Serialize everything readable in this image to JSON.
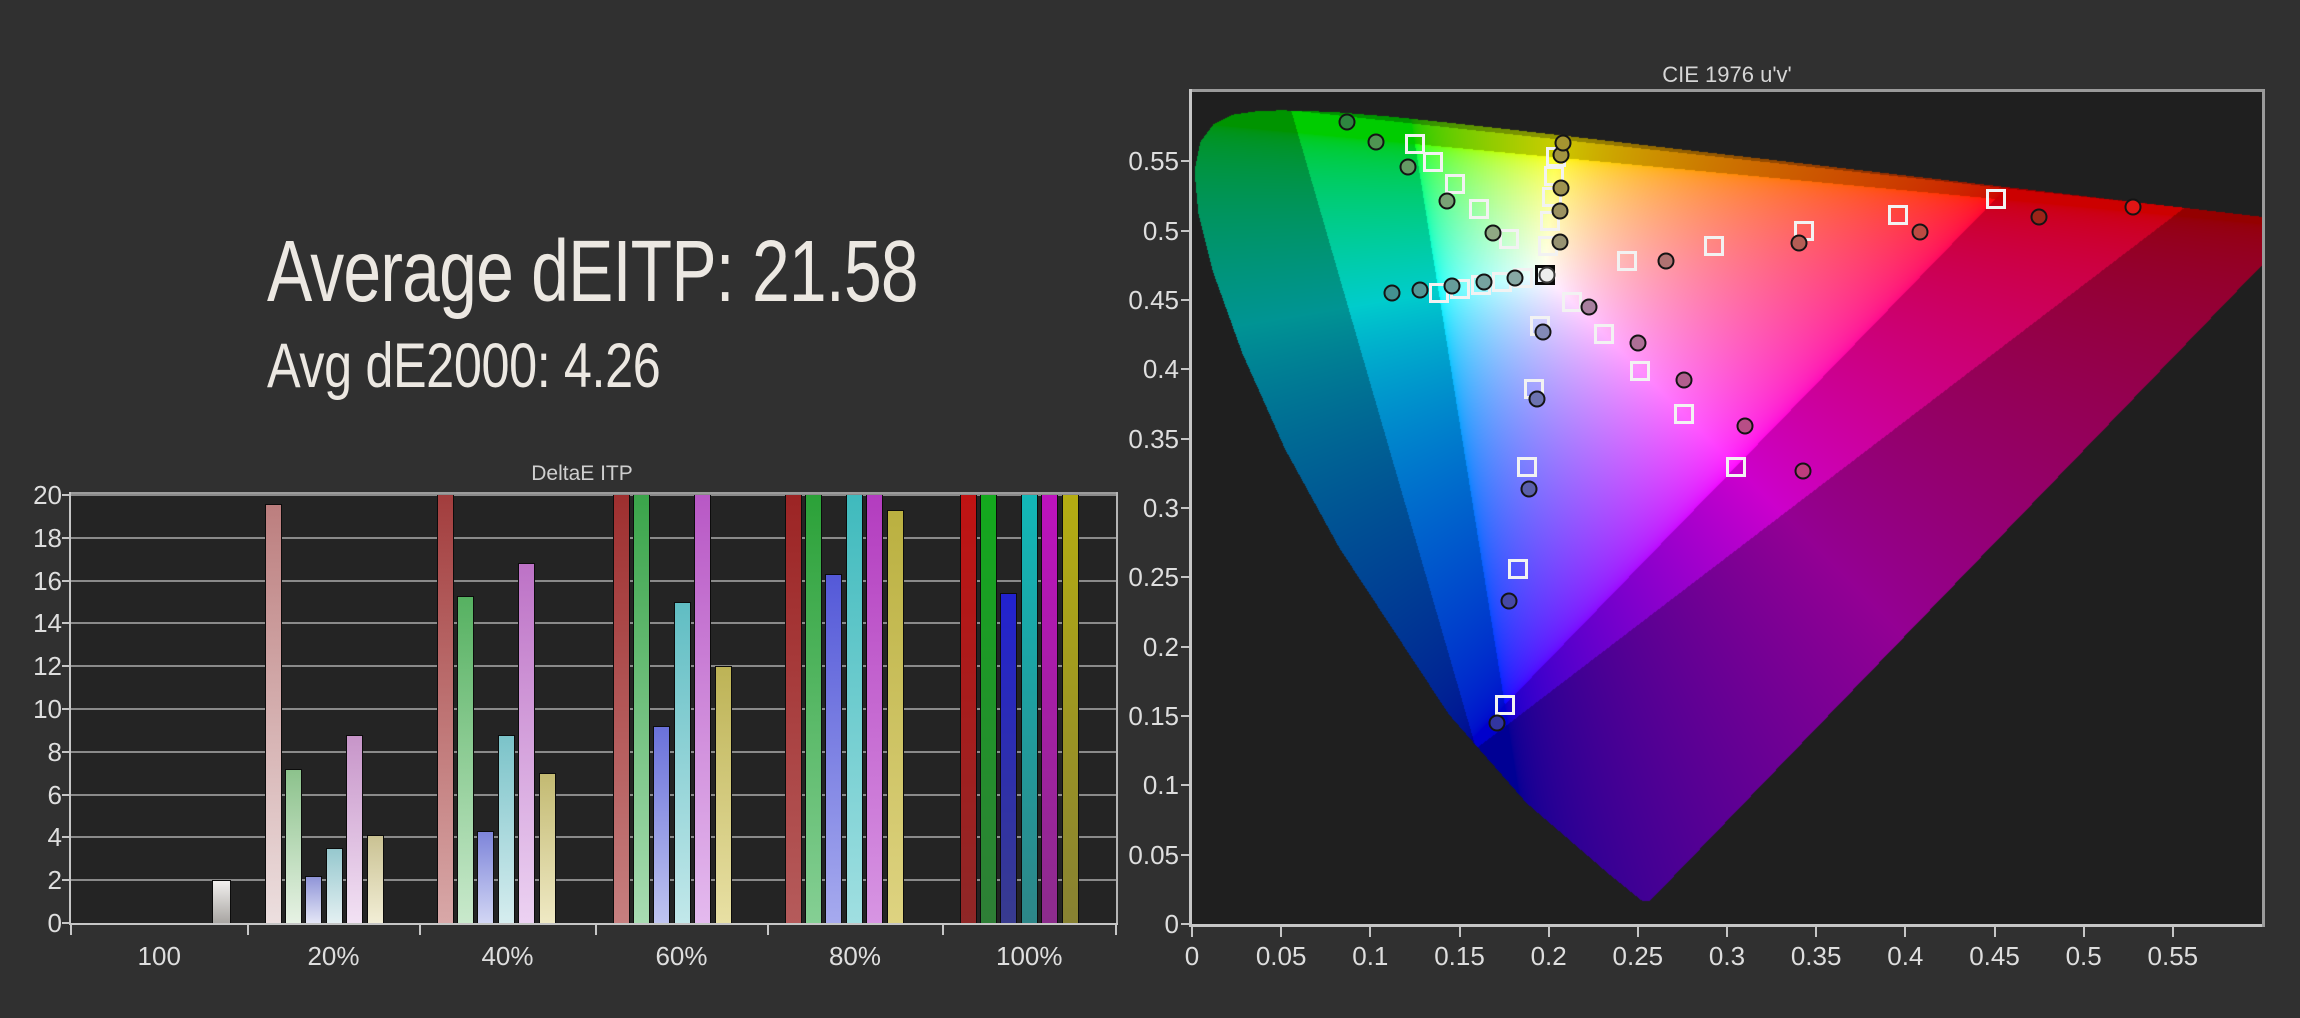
{
  "page": {
    "background": "#303030"
  },
  "summary": {
    "avg_deitp": "Average dEITP: 21.58",
    "avg_de2000": "Avg dE2000: 4.26"
  },
  "chart_data": [
    {
      "type": "bar",
      "title": "DeltaE ITP",
      "xlabel": "",
      "ylabel": "",
      "ylim": [
        0,
        20
      ],
      "yticks": [
        0,
        2,
        4,
        6,
        8,
        10,
        12,
        14,
        16,
        18,
        20
      ],
      "categories": [
        "100",
        "20%",
        "40%",
        "60%",
        "80%",
        "100%"
      ],
      "series_order": [
        "white",
        "red",
        "green",
        "blue",
        "cyan",
        "magenta",
        "yellow"
      ],
      "groups": [
        {
          "label": "100",
          "bars": [
            {
              "series": "white",
              "value": 2.0,
              "clipped": false,
              "color_top": "#f2f0ee",
              "color_bottom": "#a8a5a2"
            }
          ]
        },
        {
          "label": "20%",
          "bars": [
            {
              "series": "red",
              "value": 19.6,
              "clipped": false,
              "color_top": "#bc7e7e",
              "color_bottom": "#ecdfdf"
            },
            {
              "series": "green",
              "value": 7.2,
              "clipped": false,
              "color_top": "#8cc28c",
              "color_bottom": "#e7f2e4"
            },
            {
              "series": "blue",
              "value": 2.2,
              "clipped": false,
              "color_top": "#9095d8",
              "color_bottom": "#e4e6f6"
            },
            {
              "series": "cyan",
              "value": 3.5,
              "clipped": false,
              "color_top": "#96c8ce",
              "color_bottom": "#e4f0f2"
            },
            {
              "series": "magenta",
              "value": 8.8,
              "clipped": false,
              "color_top": "#c795c9",
              "color_bottom": "#f2e2f4"
            },
            {
              "series": "yellow",
              "value": 4.1,
              "clipped": false,
              "color_top": "#cac293",
              "color_bottom": "#f2eed6"
            }
          ]
        },
        {
          "label": "40%",
          "bars": [
            {
              "series": "red",
              "value": 20,
              "clipped": true,
              "color_top": "#a23d3d",
              "color_bottom": "#d8a8a8"
            },
            {
              "series": "green",
              "value": 15.3,
              "clipped": false,
              "color_top": "#56b161",
              "color_bottom": "#c9e9cc"
            },
            {
              "series": "blue",
              "value": 4.3,
              "clipped": false,
              "color_top": "#7e85da",
              "color_bottom": "#d2d6f4"
            },
            {
              "series": "cyan",
              "value": 8.8,
              "clipped": false,
              "color_top": "#7bc3c9",
              "color_bottom": "#d6edef"
            },
            {
              "series": "magenta",
              "value": 16.8,
              "clipped": false,
              "color_top": "#bd72c6",
              "color_bottom": "#ecd2f2"
            },
            {
              "series": "yellow",
              "value": 7.0,
              "clipped": false,
              "color_top": "#c3ba72",
              "color_bottom": "#efe9c4"
            }
          ]
        },
        {
          "label": "60%",
          "bars": [
            {
              "series": "red",
              "value": 20,
              "clipped": true,
              "color_top": "#9e2f2f",
              "color_bottom": "#c67f7f"
            },
            {
              "series": "green",
              "value": 20,
              "clipped": true,
              "color_top": "#3aa44a",
              "color_bottom": "#a8dcb2"
            },
            {
              "series": "blue",
              "value": 9.2,
              "clipped": false,
              "color_top": "#6a71da",
              "color_bottom": "#bfc4f0"
            },
            {
              "series": "cyan",
              "value": 15.0,
              "clipped": false,
              "color_top": "#60bdc3",
              "color_bottom": "#c2e8ea"
            },
            {
              "series": "magenta",
              "value": 20,
              "clipped": true,
              "color_top": "#b858c5",
              "color_bottom": "#e4baee"
            },
            {
              "series": "yellow",
              "value": 12.0,
              "clipped": false,
              "color_top": "#bdb356",
              "color_bottom": "#e8e0a4"
            }
          ]
        },
        {
          "label": "80%",
          "bars": [
            {
              "series": "red",
              "value": 20,
              "clipped": true,
              "color_top": "#9c2424",
              "color_bottom": "#b55b5b"
            },
            {
              "series": "green",
              "value": 20,
              "clipped": true,
              "color_top": "#2ba138",
              "color_bottom": "#85cf94"
            },
            {
              "series": "blue",
              "value": 16.3,
              "clipped": false,
              "color_top": "#5459d8",
              "color_bottom": "#a6aaee"
            },
            {
              "series": "cyan",
              "value": 20,
              "clipped": true,
              "color_top": "#3fbabd",
              "color_bottom": "#a0dfe1"
            },
            {
              "series": "magenta",
              "value": 20,
              "clipped": true,
              "color_top": "#b33cbf",
              "color_bottom": "#d795e3"
            },
            {
              "series": "yellow",
              "value": 19.3,
              "clipped": false,
              "color_top": "#bab040",
              "color_bottom": "#ded381"
            }
          ]
        },
        {
          "label": "100%",
          "bars": [
            {
              "series": "red",
              "value": 20,
              "clipped": true,
              "color_top": "#c01313",
              "color_bottom": "#8e2727"
            },
            {
              "series": "green",
              "value": 20,
              "clipped": true,
              "color_top": "#13a91d",
              "color_bottom": "#2e7e36"
            },
            {
              "series": "blue",
              "value": 15.4,
              "clipped": false,
              "color_top": "#2222cf",
              "color_bottom": "#383b8e"
            },
            {
              "series": "cyan",
              "value": 20,
              "clipped": true,
              "color_top": "#12b7b7",
              "color_bottom": "#2d8688"
            },
            {
              "series": "magenta",
              "value": 20,
              "clipped": true,
              "color_top": "#bd12bd",
              "color_bottom": "#8c2c8c"
            },
            {
              "series": "yellow",
              "value": 20,
              "clipped": true,
              "color_top": "#b5ad12",
              "color_bottom": "#878132"
            }
          ]
        }
      ]
    },
    {
      "type": "scatter",
      "title": "CIE 1976 u'v'",
      "xlim": [
        0,
        0.6
      ],
      "ylim": [
        0,
        0.6
      ],
      "xtick_labels": [
        "0",
        "0.05",
        "0.1",
        "0.15",
        "0.2",
        "0.25",
        "0.3",
        "0.35",
        "0.4",
        "0.45",
        "0.5",
        "0.55"
      ],
      "xtick_values": [
        0,
        0.05,
        0.1,
        0.15,
        0.2,
        0.25,
        0.3,
        0.35,
        0.4,
        0.45,
        0.5,
        0.55
      ],
      "ytick_labels": [
        "0",
        "0.05",
        "0.1",
        "0.15",
        "0.2",
        "0.25",
        "0.3",
        "0.35",
        "0.4",
        "0.45",
        "0.5",
        "0.55"
      ],
      "ytick_values": [
        0,
        0.05,
        0.1,
        0.15,
        0.2,
        0.25,
        0.3,
        0.35,
        0.4,
        0.45,
        0.5,
        0.55
      ],
      "white_point_target": {
        "name": "white-point",
        "u": 0.1978,
        "v": 0.4683
      },
      "white_point_measured": {
        "name": "white-point",
        "u": 0.199,
        "v": 0.468,
        "color": "#ededed"
      },
      "targets": [
        {
          "name": "red-20",
          "u": 0.2442,
          "v": 0.4783
        },
        {
          "name": "red-40",
          "u": 0.2925,
          "v": 0.4888
        },
        {
          "name": "red-60",
          "u": 0.3431,
          "v": 0.4996
        },
        {
          "name": "red-80",
          "u": 0.3957,
          "v": 0.511
        },
        {
          "name": "red-100",
          "u": 0.4507,
          "v": 0.5229
        },
        {
          "name": "green-20",
          "u": 0.1778,
          "v": 0.4942
        },
        {
          "name": "green-40",
          "u": 0.1612,
          "v": 0.5157
        },
        {
          "name": "green-60",
          "u": 0.1472,
          "v": 0.5338
        },
        {
          "name": "green-80",
          "u": 0.1353,
          "v": 0.5492
        },
        {
          "name": "green-100",
          "u": 0.125,
          "v": 0.5625
        },
        {
          "name": "blue-20",
          "u": 0.1952,
          "v": 0.4313
        },
        {
          "name": "blue-40",
          "u": 0.1918,
          "v": 0.3861
        },
        {
          "name": "blue-60",
          "u": 0.1878,
          "v": 0.3293
        },
        {
          "name": "blue-80",
          "u": 0.1826,
          "v": 0.2561
        },
        {
          "name": "blue-100",
          "u": 0.1754,
          "v": 0.1579
        },
        {
          "name": "cyan-20",
          "u": 0.1857,
          "v": 0.4656
        },
        {
          "name": "cyan-40",
          "u": 0.1737,
          "v": 0.4631
        },
        {
          "name": "cyan-60",
          "u": 0.1618,
          "v": 0.4605
        },
        {
          "name": "cyan-80",
          "u": 0.15,
          "v": 0.458
        },
        {
          "name": "cyan-100",
          "u": 0.1383,
          "v": 0.4554
        },
        {
          "name": "magenta-20",
          "u": 0.2131,
          "v": 0.4485
        },
        {
          "name": "magenta-40",
          "u": 0.2308,
          "v": 0.4257
        },
        {
          "name": "magenta-60",
          "u": 0.2514,
          "v": 0.3991
        },
        {
          "name": "magenta-80",
          "u": 0.2758,
          "v": 0.3675
        },
        {
          "name": "magenta-100",
          "u": 0.305,
          "v": 0.3297
        },
        {
          "name": "yellow-20",
          "u": 0.1994,
          "v": 0.489
        },
        {
          "name": "yellow-40",
          "u": 0.2006,
          "v": 0.5073
        },
        {
          "name": "yellow-60",
          "u": 0.2021,
          "v": 0.5243
        },
        {
          "name": "yellow-80",
          "u": 0.203,
          "v": 0.5393
        },
        {
          "name": "yellow-100",
          "u": 0.2039,
          "v": 0.5529
        }
      ],
      "measurements": [
        {
          "name": "red-20",
          "u": 0.266,
          "v": 0.478,
          "color": "#b07272"
        },
        {
          "name": "red-40",
          "u": 0.3406,
          "v": 0.4909,
          "color": "#b55d55"
        },
        {
          "name": "red-60",
          "u": 0.4082,
          "v": 0.4993,
          "color": "#bc4a42"
        },
        {
          "name": "red-80",
          "u": 0.4748,
          "v": 0.5101,
          "color": "#9c2418"
        },
        {
          "name": "red-100",
          "u": 0.5275,
          "v": 0.5173,
          "color": "#e01515"
        },
        {
          "name": "green-20",
          "u": 0.1687,
          "v": 0.4981,
          "color": "#8fa883"
        },
        {
          "name": "green-40",
          "u": 0.1432,
          "v": 0.5211,
          "color": "#79a275"
        },
        {
          "name": "green-60",
          "u": 0.1214,
          "v": 0.546,
          "color": "#659a64"
        },
        {
          "name": "green-80",
          "u": 0.1033,
          "v": 0.564,
          "color": "#4f9452"
        },
        {
          "name": "green-100",
          "u": 0.0868,
          "v": 0.5786,
          "color": "#2e8540"
        },
        {
          "name": "blue-20",
          "u": 0.1967,
          "v": 0.4268,
          "color": "#8289b5"
        },
        {
          "name": "blue-40",
          "u": 0.1934,
          "v": 0.3789,
          "color": "#6d73b0"
        },
        {
          "name": "blue-60",
          "u": 0.189,
          "v": 0.3134,
          "color": "#5a5fab"
        },
        {
          "name": "blue-80",
          "u": 0.178,
          "v": 0.233,
          "color": "#4648a5"
        },
        {
          "name": "blue-100",
          "u": 0.171,
          "v": 0.145,
          "color": "#32359f"
        },
        {
          "name": "cyan-20",
          "u": 0.1813,
          "v": 0.466,
          "color": "#87a8a4"
        },
        {
          "name": "cyan-40",
          "u": 0.1636,
          "v": 0.4628,
          "color": "#76a3a0"
        },
        {
          "name": "cyan-60",
          "u": 0.1458,
          "v": 0.4602,
          "color": "#659d9b"
        },
        {
          "name": "cyan-80",
          "u": 0.128,
          "v": 0.4573,
          "color": "#549795"
        },
        {
          "name": "cyan-100",
          "u": 0.1121,
          "v": 0.4552,
          "color": "#439190"
        },
        {
          "name": "magenta-20",
          "u": 0.2227,
          "v": 0.4451,
          "color": "#a87f9e"
        },
        {
          "name": "magenta-40",
          "u": 0.2501,
          "v": 0.419,
          "color": "#ad6f96"
        },
        {
          "name": "magenta-60",
          "u": 0.2759,
          "v": 0.3923,
          "color": "#b25e8e"
        },
        {
          "name": "magenta-80",
          "u": 0.3101,
          "v": 0.3592,
          "color": "#b84e86"
        },
        {
          "name": "magenta-100",
          "u": 0.3427,
          "v": 0.3269,
          "color": "#bd3d7d"
        },
        {
          "name": "yellow-20",
          "u": 0.2066,
          "v": 0.4916,
          "color": "#979372"
        },
        {
          "name": "yellow-40",
          "u": 0.2066,
          "v": 0.514,
          "color": "#9b9260"
        },
        {
          "name": "yellow-60",
          "u": 0.207,
          "v": 0.531,
          "color": "#9e9350"
        },
        {
          "name": "yellow-80",
          "u": 0.207,
          "v": 0.5547,
          "color": "#a29440"
        },
        {
          "name": "yellow-100",
          "u": 0.208,
          "v": 0.563,
          "color": "#a59530"
        }
      ],
      "gamuts": {
        "rec709": [
          [
            0.4507,
            0.5229
          ],
          [
            0.125,
            0.5625
          ],
          [
            0.1754,
            0.1579
          ]
        ],
        "rec2020": [
          [
            0.5566,
            0.5165
          ],
          [
            0.0556,
            0.5868
          ],
          [
            0.1593,
            0.1265
          ]
        ]
      },
      "zone_brightness": {
        "rec709": 1.0,
        "rec2020": 0.8,
        "outside": 0.58
      },
      "spectral_locus": [
        [
          0.6234,
          0.5065
        ],
        [
          0.583,
          0.5125
        ],
        [
          0.5203,
          0.5219
        ],
        [
          0.4691,
          0.5296
        ],
        [
          0.4035,
          0.5393
        ],
        [
          0.3315,
          0.5501
        ],
        [
          0.2623,
          0.5604
        ],
        [
          0.2026,
          0.5694
        ],
        [
          0.1531,
          0.5766
        ],
        [
          0.1127,
          0.5821
        ],
        [
          0.0792,
          0.5856
        ],
        [
          0.0501,
          0.5868
        ],
        [
          0.036,
          0.5861
        ],
        [
          0.0231,
          0.5837
        ],
        [
          0.0123,
          0.577
        ],
        [
          0.0046,
          0.5639
        ],
        [
          0.0014,
          0.5432
        ],
        [
          0.0035,
          0.5131
        ],
        [
          0.0119,
          0.4698
        ],
        [
          0.0282,
          0.4117
        ],
        [
          0.0521,
          0.3427
        ],
        [
          0.0828,
          0.2708
        ],
        [
          0.1441,
          0.151
        ],
        [
          0.1877,
          0.0871
        ],
        [
          0.2347,
          0.035
        ],
        [
          0.2522,
          0.0169
        ],
        [
          0.2568,
          0.0166
        ]
      ]
    }
  ]
}
